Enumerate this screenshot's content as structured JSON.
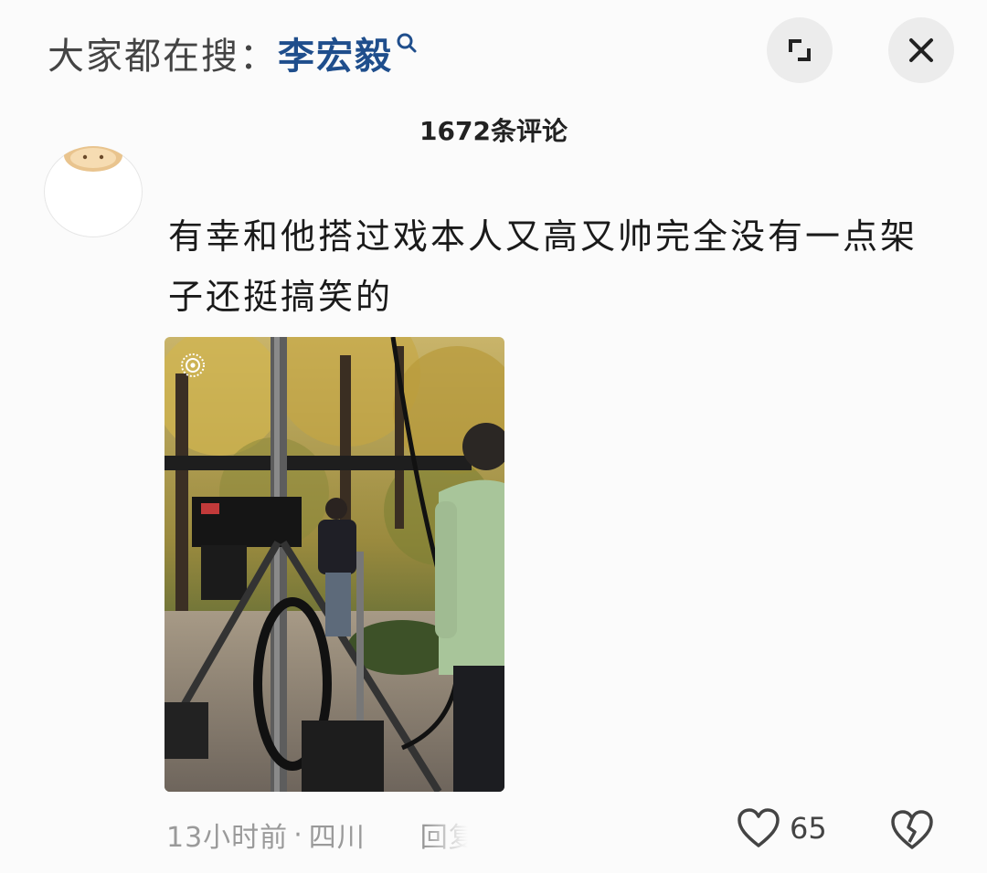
{
  "search": {
    "prefix": "大家都在搜：",
    "term": "李宏毅"
  },
  "header": {
    "comment_count_title": "1672条评论"
  },
  "comment": {
    "text": "有幸和他搭过戏本人又高又帅完全没有一点架子还挺搞笑的",
    "time": "13小时前",
    "separator": "·",
    "location": "四川",
    "reply_label": "回复",
    "likes": "65"
  },
  "icons": {
    "search": "search-icon",
    "expand": "expand-icon",
    "close": "close-icon",
    "like": "heart-icon",
    "dislike": "broken-heart-icon",
    "live_photo": "live-photo-icon"
  },
  "colors": {
    "search_term": "#1f4e8c",
    "background": "#fbfbfb",
    "meta_text": "#9a9a9a"
  }
}
